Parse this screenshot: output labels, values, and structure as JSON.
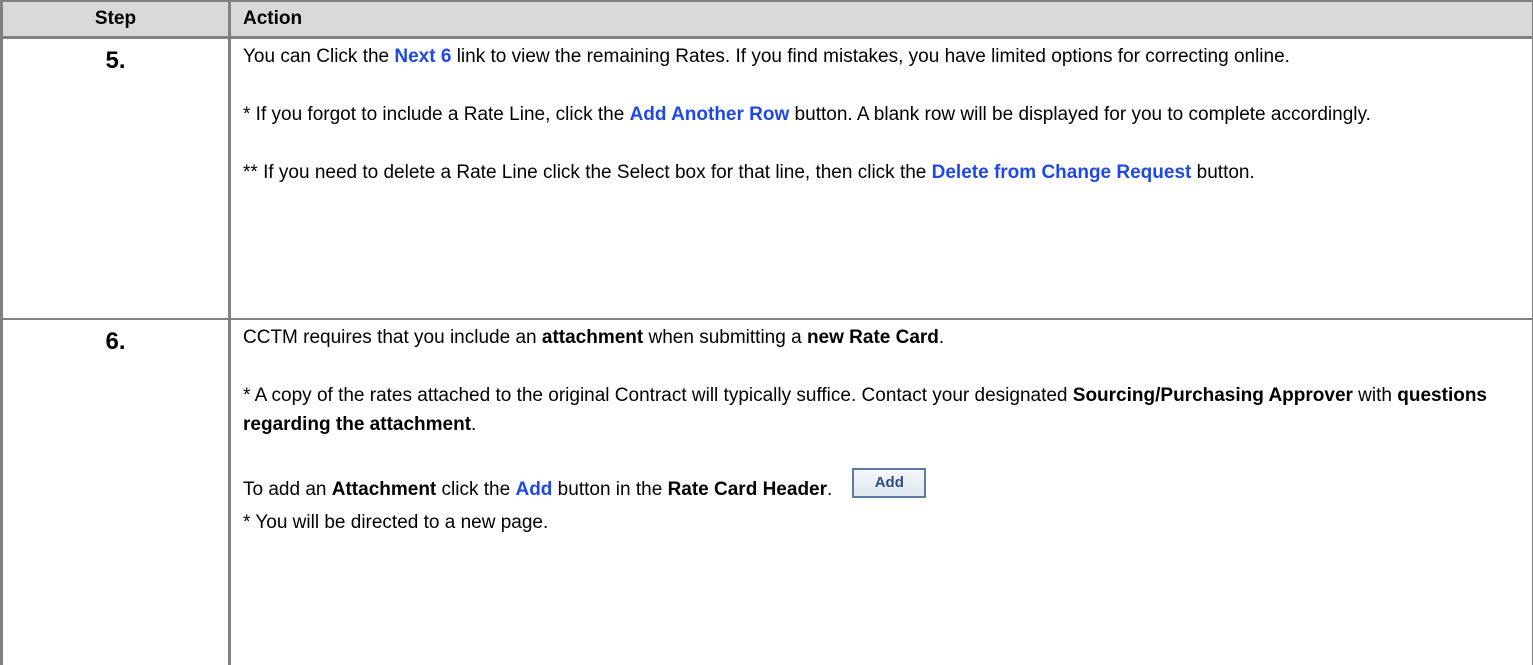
{
  "header": {
    "step": "Step",
    "action": "Action"
  },
  "rows": [
    {
      "step": "5.",
      "p1": {
        "a": "You can Click the ",
        "link": "Next 6",
        "b": " link to view the remaining Rates.  If you find mistakes, you have limited options for correcting online."
      },
      "p2": {
        "a": "* If you forgot to include a Rate Line, click the ",
        "link": "Add Another Row",
        "b": " button.  A blank row will be displayed for you to complete accordingly."
      },
      "p3": {
        "a": "** If you need to delete a Rate Line click the Select box for that line, then click the ",
        "link": "Delete from Change Request",
        "b": " button."
      }
    },
    {
      "step": "6.",
      "p1": {
        "a": "CCTM requires that you include an ",
        "bold1": "attachment",
        "b": " when submitting a ",
        "bold2": "new Rate Card",
        "c": "."
      },
      "p2": {
        "a": " * A copy of the rates attached to the original Contract will typically suffice.  Contact your designated ",
        "bold1": "Sourcing/Purchasing Approver",
        "b": " with ",
        "bold2": "questions regarding the attachment",
        "c": "."
      },
      "p3": {
        "a": "To add an ",
        "bold1": "Attachment",
        "b": " click the ",
        "link": "Add",
        "c": " button in the ",
        "bold2": "Rate Card Header",
        "d": ".",
        "button_label": "Add"
      },
      "p4": "* You will be directed to a new page."
    }
  ]
}
